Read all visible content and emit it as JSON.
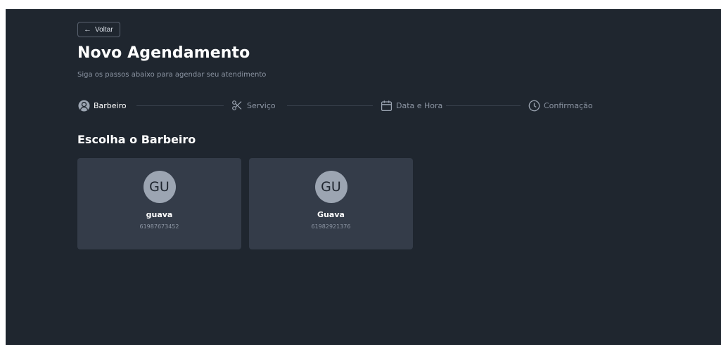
{
  "header": {
    "back_label": "Voltar",
    "title": "Novo Agendamento",
    "subtitle": "Siga os passos abaixo para agendar seu atendimento"
  },
  "stepper": {
    "steps": [
      {
        "label": "Barbeiro",
        "icon": "user-icon",
        "active": true
      },
      {
        "label": "Serviço",
        "icon": "scissors-icon",
        "active": false
      },
      {
        "label": "Data e Hora",
        "icon": "calendar-icon",
        "active": false
      },
      {
        "label": "Confirmação",
        "icon": "clock-icon",
        "active": false
      }
    ]
  },
  "section": {
    "title": "Escolha o Barbeiro"
  },
  "barbers": [
    {
      "initials": "GU",
      "name": "guava",
      "phone": "61987673452"
    },
    {
      "initials": "GU",
      "name": "Guava",
      "phone": "61982921376"
    }
  ],
  "colors": {
    "background": "#1f262f",
    "card": "#343c49",
    "avatar": "#9ca5b2",
    "muted_text": "#8c95a3"
  }
}
